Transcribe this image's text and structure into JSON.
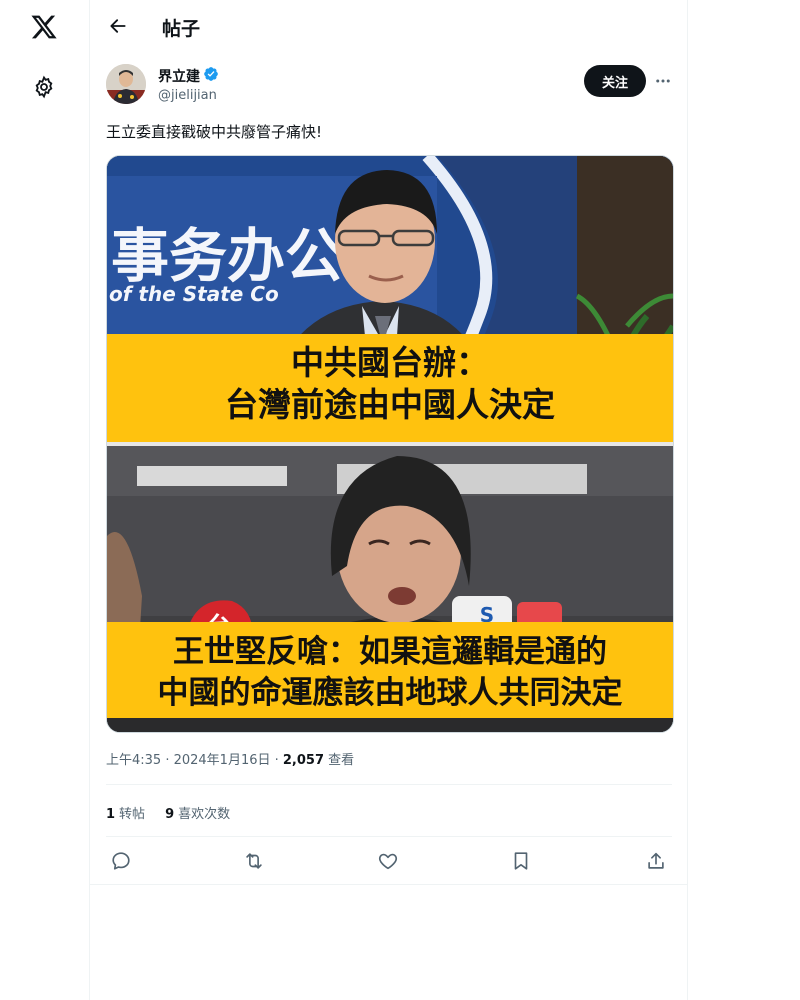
{
  "nav": {
    "logo": "x-logo-icon",
    "settings": "gear-icon"
  },
  "header": {
    "title": "帖子"
  },
  "author": {
    "name": "界立建",
    "handle": "@jielijian",
    "verified_color": "#1d9bf0"
  },
  "follow_label": "关注",
  "post": {
    "text": "王立委直接戳破中共廢管子痛快!",
    "image": {
      "sign_text": "事务办公",
      "sign_english": "of the State Co",
      "caption_top_line1": "中共國台辦：",
      "caption_top_line2": "台灣前途由中國人決定",
      "caption_bottom_line1": "王世堅反嗆：如果這邏輯是通的",
      "caption_bottom_line2": "中國的命運應該由地球人共同決定",
      "mic_label_1": "台",
      "mic_label_2": "S"
    }
  },
  "meta": {
    "time_date": "上午4:35 · 2024年1月16日 · ",
    "views_count": "2,057",
    "views_label": " 查看"
  },
  "stats": {
    "reposts_count": "1",
    "reposts_label": "转帖",
    "likes_count": "9",
    "likes_label": "喜欢次数"
  },
  "actions": [
    "reply-icon",
    "repost-icon",
    "like-icon",
    "bookmark-icon",
    "share-icon"
  ],
  "colors": {
    "caption_band": "#ffc20e",
    "follow_bg": "#0f1419",
    "muted": "#536471"
  }
}
